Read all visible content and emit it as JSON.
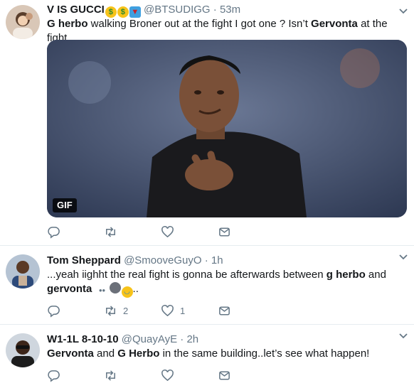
{
  "tweets": [
    {
      "name": "V IS GUCCI",
      "handle": "@BTSUDIGG",
      "separator": "·",
      "time": "53m",
      "text_parts": [
        "G herbo",
        " walking Broner out at the fight I got one ? Isn’t ",
        "Gervonta",
        " at the fight."
      ],
      "media_badge": "GIF",
      "actions": {
        "reply": "",
        "retweet": "",
        "like": ""
      }
    },
    {
      "name": "Tom Sheppard",
      "handle": "@SmooveGuyO",
      "separator": "·",
      "time": "1h",
      "text_parts": [
        "...yeah iighht the real fight is gonna be afterwards between ",
        "g herbo",
        " and ",
        "gervonta",
        " ",
        ".."
      ],
      "actions": {
        "reply": "",
        "retweet": "2",
        "like": "1"
      }
    },
    {
      "name": "W1-1L 8-10-10",
      "handle": "@QuayAyE",
      "separator": "·",
      "time": "2h",
      "text_parts": [
        "Gervonta",
        " and ",
        "G Herbo",
        " in the same building..let’s see what happen!"
      ],
      "actions": {
        "reply": "",
        "retweet": "",
        "like": ""
      }
    }
  ],
  "icons": {
    "reply": "reply-icon",
    "retweet": "retweet-icon",
    "like": "heart-icon",
    "dm": "direct-message-icon",
    "more": "chevron-down-icon"
  },
  "colors": {
    "text": "#14171a",
    "muted": "#657786",
    "border": "#e6ecf0"
  }
}
